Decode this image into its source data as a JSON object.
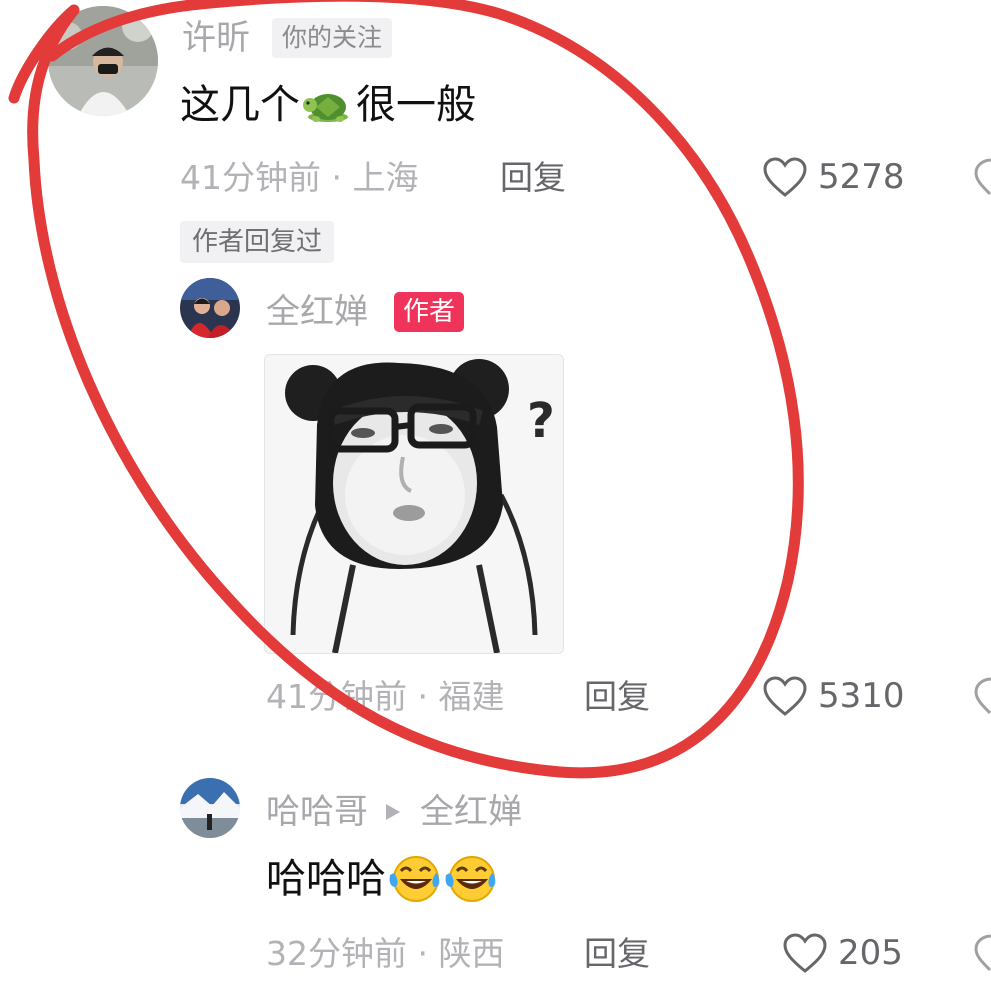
{
  "comment1": {
    "username": "许昕",
    "follow_tag": "你的关注",
    "text": "这几个",
    "text_after_emoji": "很一般",
    "emoji": "turtle-emoji",
    "time_location": "41分钟前 · 上海",
    "reply_label": "回复",
    "likes": "5278",
    "author_replied_tag": "作者回复过"
  },
  "reply1": {
    "username": "全红婵",
    "author_badge": "作者",
    "sticker": "bear-ear-meme-sticker",
    "time_location": "41分钟前 · 福建",
    "reply_label": "回复",
    "likes": "5310"
  },
  "reply2": {
    "username": "哈哈哥",
    "reply_to": "全红婵",
    "text": "哈哈哈",
    "emoji": "laughing-tears-emoji",
    "time_location": "32分钟前 · 陕西",
    "reply_label": "回复",
    "likes": "205"
  },
  "colors": {
    "annotation_circle": "#e33a3a",
    "author_badge": "#f0335a"
  }
}
